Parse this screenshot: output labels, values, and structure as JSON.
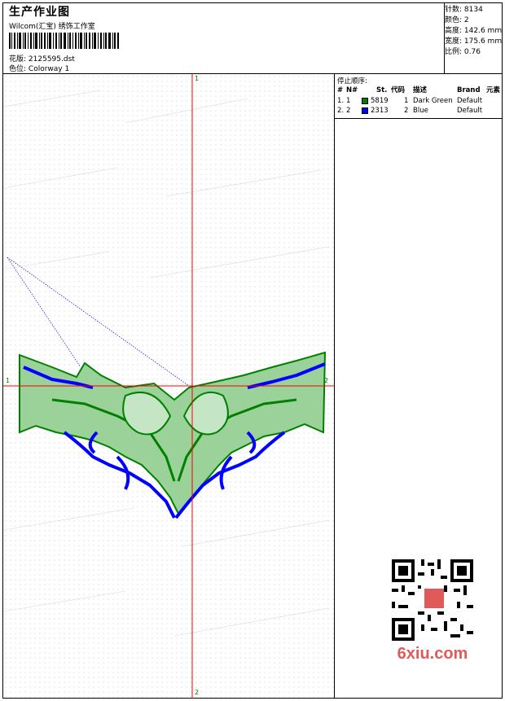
{
  "header": {
    "title": "生产作业图",
    "subtitle": "Wilcom(汇宝) 绣饰工作室",
    "design_label": "花版:",
    "design_value": "2125595.dst",
    "color_label": "色位:",
    "color_value": "Colorway 1"
  },
  "stats": [
    {
      "label": "针数:",
      "value": "8134"
    },
    {
      "label": "颜色:",
      "value": "2"
    },
    {
      "label": "高度:",
      "value": "142.6 mm"
    },
    {
      "label": "宽度:",
      "value": "175.6 mm"
    },
    {
      "label": "比例:",
      "value": "0.76"
    }
  ],
  "stop_sequence": {
    "title": "停止顺序:",
    "columns": [
      "#",
      "N#",
      "St.",
      "代码",
      "描述",
      "Brand",
      "元素"
    ],
    "rows": [
      {
        "idx": "1.",
        "n": "1",
        "color": "#008000",
        "st": "5819",
        "code": "1",
        "desc": "Dark Green",
        "brand": "Default"
      },
      {
        "idx": "2.",
        "n": "2",
        "color": "#0000ff",
        "st": "2313",
        "code": "2",
        "desc": "Blue",
        "brand": "Default"
      }
    ]
  },
  "axes": {
    "top_label": "1",
    "bottom_label": "2",
    "left_label": "1",
    "right_label": "2",
    "axis_color": "#ff0000"
  },
  "design_colors": {
    "green": "#008000",
    "blue": "#0000ff"
  },
  "watermark": {
    "text": "6xiu.com",
    "icon": "qr-code-icon"
  }
}
